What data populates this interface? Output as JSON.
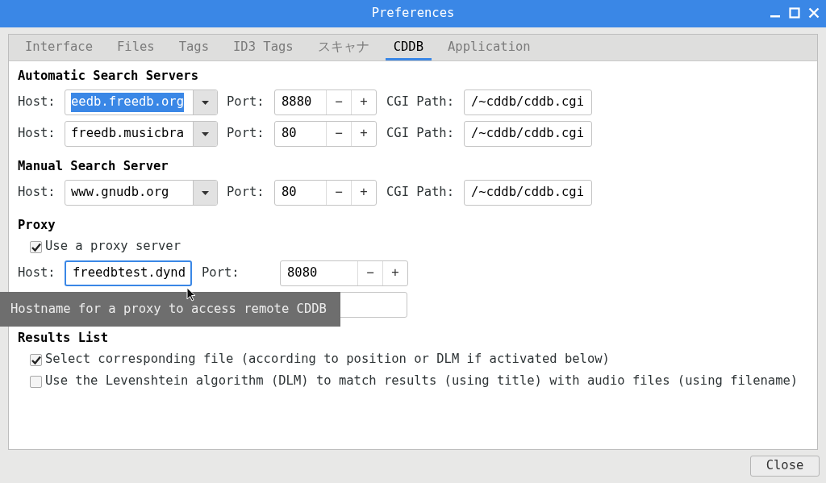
{
  "window": {
    "title": "Preferences"
  },
  "tabs": [
    {
      "label": "Interface",
      "selected": false
    },
    {
      "label": "Files",
      "selected": false
    },
    {
      "label": "Tags",
      "selected": false
    },
    {
      "label": "ID3 Tags",
      "selected": false
    },
    {
      "label": "スキャナ",
      "selected": false
    },
    {
      "label": "CDDB",
      "selected": true
    },
    {
      "label": "Application",
      "selected": false
    }
  ],
  "sections": [
    {
      "heading": "Automatic Search Servers",
      "servers": [
        {
          "host_label": "Host:",
          "host": "eedb.freedb.org",
          "host_selected": true,
          "port_label": "Port:",
          "port": "8880",
          "minus": "−",
          "plus": "+",
          "cgi_label": "CGI Path:",
          "cgi_path": "/~cddb/cddb.cgi"
        },
        {
          "host_label": "Host:",
          "host": "freedb.musicbra",
          "host_selected": false,
          "port_label": "Port:",
          "port": "80",
          "minus": "−",
          "plus": "+",
          "cgi_label": "CGI Path:",
          "cgi_path": "/~cddb/cddb.cgi"
        }
      ]
    },
    {
      "heading": "Manual Search Server",
      "servers": [
        {
          "host_label": "Host:",
          "host": "www.gnudb.org",
          "host_selected": false,
          "port_label": "Port:",
          "port": "80",
          "minus": "−",
          "plus": "+",
          "cgi_label": "CGI Path:",
          "cgi_path": "/~cddb/cddb.cgi"
        }
      ]
    }
  ],
  "proxy": {
    "heading": "Proxy",
    "use_proxy": {
      "label": "Use a proxy server",
      "checked": true
    },
    "host_label": "Host:",
    "host": "freedbtest.dynd",
    "host_focused": true,
    "port_label": "Port:",
    "port": "8080",
    "minus": "−",
    "plus": "+"
  },
  "tooltip": "Hostname for a proxy to access remote CDDB",
  "results_list": {
    "heading": "Results List",
    "options": [
      {
        "label": "Select corresponding file (according to position or DLM if activated below)",
        "checked": true
      },
      {
        "label": "Use the Levenshtein algorithm (DLM) to match results (using title) with audio files (using filename)",
        "checked": false
      }
    ]
  },
  "buttons": [
    {
      "label": "Close"
    }
  ]
}
